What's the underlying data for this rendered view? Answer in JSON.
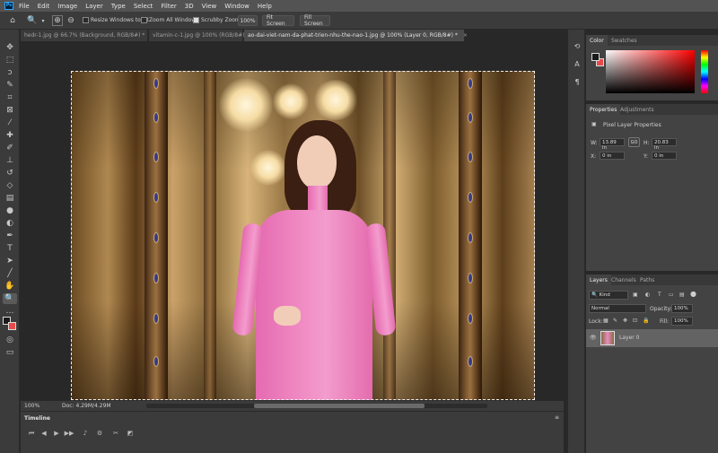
{
  "menubar": {
    "logo": "Ps",
    "items": [
      "File",
      "Edit",
      "Image",
      "Layer",
      "Type",
      "Select",
      "Filter",
      "3D",
      "View",
      "Window",
      "Help"
    ]
  },
  "options": {
    "resize_windows_label": "Resize Windows to Fit",
    "zoom_all_label": "Zoom All Windows",
    "scrubby_zoom_label": "Scrubby Zoom",
    "zoom_100_label": "100%",
    "fit_screen_label": "Fit Screen",
    "fill_screen_label": "Fill Screen",
    "resize_windows_checked": false,
    "zoom_all_checked": false,
    "scrubby_zoom_checked": true
  },
  "tabs": [
    {
      "label": "hedr-1.jpg @ 66.7% (Background, RGB/8#) *",
      "active": false
    },
    {
      "label": "vitamin-c-1.jpg @ 100% (RGB/8#)",
      "active": false
    },
    {
      "label": "ao-dai-viet-nam-da-phat-trien-nhu-the-nao-1.jpg @ 100% (Layer 0, RGB/8#) *",
      "active": true
    }
  ],
  "tab_close": "×",
  "toolbar": {
    "tools": [
      "move-tool",
      "marquee-tool",
      "lasso-tool",
      "quick-select-tool",
      "crop-tool",
      "frame-tool",
      "eyedropper-tool",
      "healing-tool",
      "brush-tool",
      "clone-stamp-tool",
      "history-brush-tool",
      "eraser-tool",
      "gradient-tool",
      "blur-tool",
      "dodge-tool",
      "pen-tool",
      "type-tool",
      "path-select-tool",
      "line-tool",
      "hand-tool",
      "zoom-tool"
    ],
    "active_tool": "zoom-tool"
  },
  "status": {
    "zoom": "100%",
    "doc": "Doc: 4.29M/4.29M"
  },
  "timeline": {
    "title": "Timeline"
  },
  "color_panel": {
    "tabs": [
      "Color",
      "Swatches"
    ],
    "foreground": "#1a1a1a",
    "background": "#e84a4a",
    "hue": "#ff0000"
  },
  "properties_panel": {
    "tabs": [
      "Properties",
      "Adjustments"
    ],
    "section_label": "Pixel Layer Properties",
    "w_label": "W:",
    "w_value": "13.89 in",
    "go_label": "GO",
    "h_label": "H:",
    "h_value": "20.83 in",
    "x_label": "X:",
    "x_value": "0 in",
    "y_label": "Y:",
    "y_value": "0 in"
  },
  "layers_panel": {
    "tabs": [
      "Layers",
      "Channels",
      "Paths"
    ],
    "filter_label": "Kind",
    "blend_mode": "Normal",
    "opacity_label": "Opacity:",
    "opacity_value": "100%",
    "lock_label": "Lock:",
    "fill_label": "Fill:",
    "fill_value": "100%",
    "layers": [
      {
        "name": "Layer 0",
        "visible": true
      }
    ]
  }
}
